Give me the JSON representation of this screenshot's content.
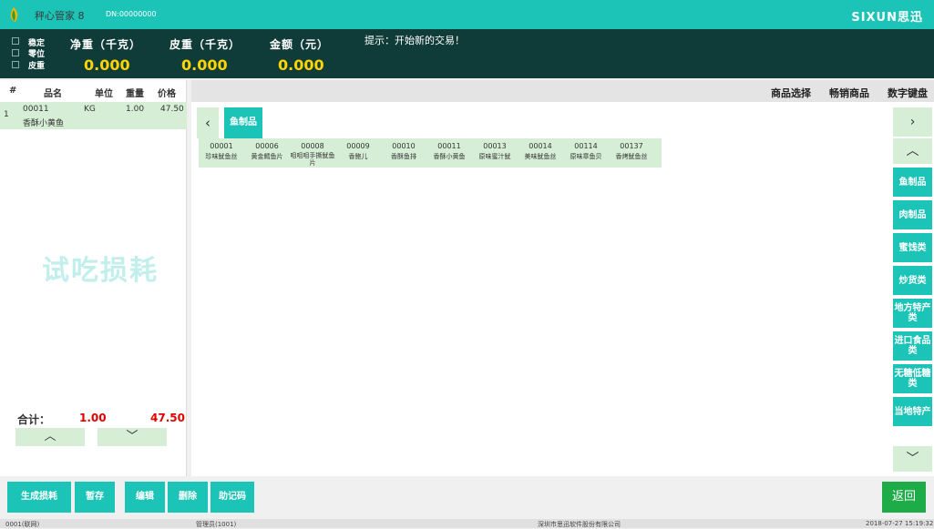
{
  "app": {
    "name": "秤心管家 8",
    "dn": "DN:00000000",
    "brand": "SIXUN思迅"
  },
  "scale": {
    "checks": [
      "稳定",
      "零位",
      "皮重"
    ],
    "headers": {
      "net": "净重（千克）",
      "tare": "皮重（千克）",
      "amount": "金额（元）"
    },
    "values": {
      "net": "0.000",
      "tare": "0.000",
      "amount": "0.000"
    },
    "hint": "提示：开始新的交易！"
  },
  "order": {
    "headers": {
      "index": "#",
      "name": "品名",
      "unit": "单位",
      "weight": "重量",
      "price": "价格"
    },
    "rows": [
      {
        "index": "1",
        "code": "00011",
        "name": "香酥小黄鱼",
        "unit": "KG",
        "weight": "1.00",
        "price": "47.50"
      }
    ],
    "watermark": "试吃损耗",
    "total_label": "合计：",
    "total_qty": "1.00",
    "total_amount": "47.50"
  },
  "tabs": [
    "商品选择",
    "畅销商品",
    "数字键盘"
  ],
  "category": {
    "current": "鱼制品"
  },
  "products": [
    {
      "code": "00001",
      "name": "珍味鱿鱼丝"
    },
    {
      "code": "00006",
      "name": "黄金鳕鱼片"
    },
    {
      "code": "00008",
      "name": "咀咀咀手撕鱿鱼片"
    },
    {
      "code": "00009",
      "name": "香鲍儿"
    },
    {
      "code": "00010",
      "name": "香酥鱼排"
    },
    {
      "code": "00011",
      "name": "香酥小黄鱼"
    },
    {
      "code": "00013",
      "name": "原味蜜汁鱿"
    },
    {
      "code": "00014",
      "name": "美味鱿鱼丝"
    },
    {
      "code": "00114",
      "name": "原味章鱼贝"
    },
    {
      "code": "00137",
      "name": "香烤鱿鱼丝"
    }
  ],
  "categories": [
    "鱼制品",
    "肉制品",
    "蜜饯类",
    "炒货类",
    "地方特产类",
    "进口食品类",
    "无糖低糖类",
    "当地特产"
  ],
  "actions": [
    "生成损耗",
    "暂存",
    "编辑",
    "删除",
    "助记码"
  ],
  "back_label": "返回",
  "status": {
    "left": "0001(联网)",
    "user": "管理员(1001)",
    "company": "深圳市思迅软件股份有限公司",
    "time": "2018-07-27 15:19:32"
  }
}
